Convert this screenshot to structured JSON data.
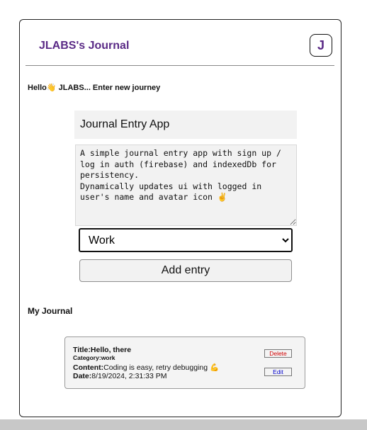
{
  "header": {
    "title": "JLABS's Journal",
    "avatar_letter": "J"
  },
  "greeting": "Hello👋 JLABS... Enter new journey",
  "form": {
    "title_value": "Journal Entry App",
    "content_value": "A simple journal entry app with sign up / log in auth (firebase) and indexedDb for persistency.\nDynamically updates ui with logged in user's name and avatar icon ✌️",
    "category_selected": "Work",
    "add_button_label": "Add entry"
  },
  "journal": {
    "heading": "My Journal",
    "entries": [
      {
        "title_label": "Title:",
        "title": "Hello, there",
        "category_label": "Category:",
        "category": "work",
        "content_label": "Content:",
        "content": "Coding is easy, retry debugging 💪",
        "date_label": "Date:",
        "date": "8/19/2024, 2:31:33 PM",
        "delete_label": "Delete",
        "edit_label": "Edit"
      }
    ]
  },
  "colors": {
    "accent": "#5a2a86",
    "delete": "#d00000",
    "edit": "#0000cc"
  }
}
